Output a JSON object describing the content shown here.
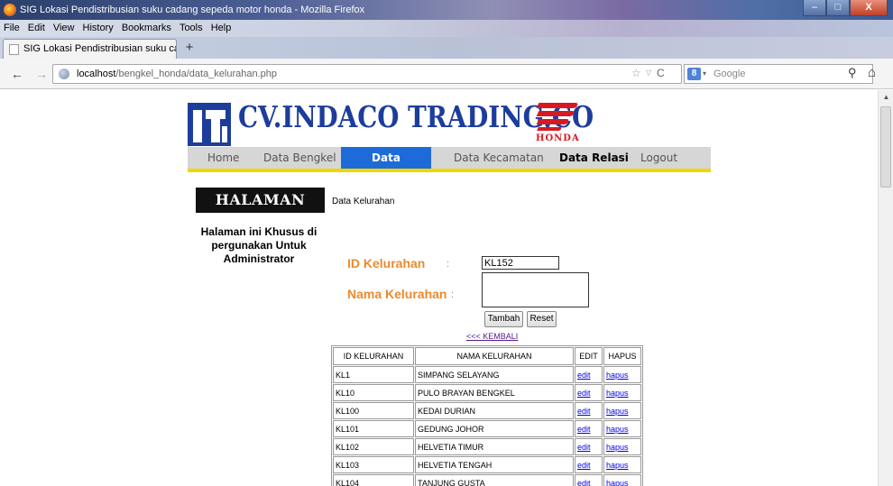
{
  "window": {
    "title": "SIG Lokasi Pendistribusian suku cadang sepeda motor honda - Mozilla Firefox",
    "controls": [
      "–",
      "□",
      "X"
    ]
  },
  "menubar": {
    "items": [
      {
        "label": "File"
      },
      {
        "label": "Edit"
      },
      {
        "label": "View"
      },
      {
        "label": "History"
      },
      {
        "label": "Bookmarks"
      },
      {
        "label": "Tools"
      },
      {
        "label": "Help"
      }
    ]
  },
  "tabs": {
    "active": "SIG Lokasi Pendistribusian suku cadang ...",
    "new_tab": "+"
  },
  "navbar": {
    "back": "←",
    "forward": "→",
    "url_host": "localhost",
    "url_path": "/bengkel_honda/data_kelurahan.php",
    "search_engine_icon": "8",
    "search_placeholder": "Google",
    "icons": {
      "star": "☆",
      "dropdown": "▽",
      "reload": "C",
      "search": "⚲",
      "home": "⌂"
    }
  },
  "page": {
    "company": "CV.INDACO TRADING.CO",
    "honda_brand": "HONDA",
    "menu": [
      {
        "label": "Home"
      },
      {
        "label": "Data Bengkel"
      },
      {
        "label": "Data Kelurahan"
      },
      {
        "label": "Data Kecamatan"
      },
      {
        "label": "Data Relasi"
      },
      {
        "label": "Logout"
      }
    ],
    "admin_title": "HALAMAN ADMIN",
    "section_title": "Data Kelurahan",
    "side_note": "Halaman ini Khusus di pergunakan Untuk Administrator",
    "form": {
      "id_label": "ID Kelurahan",
      "id_colon": ":",
      "id_value": "KL152",
      "nama_label": "Nama Kelurahan",
      "nama_colon": ":",
      "nama_value": "",
      "submit_label": "Tambah",
      "reset_label": "Reset"
    },
    "back_link": "<<< KEMBALI",
    "table": {
      "headers": [
        "ID KELURAHAN",
        "NAMA KELURAHAN",
        "EDIT",
        "HAPUS"
      ],
      "rows": [
        {
          "id": "KL1",
          "nama": "SIMPANG SELAYANG",
          "edit": "edit",
          "hapus": "hapus"
        },
        {
          "id": "KL10",
          "nama": "PULO BRAYAN BENGKEL",
          "edit": "edit",
          "hapus": "hapus"
        },
        {
          "id": "KL100",
          "nama": "KEDAI DURIAN",
          "edit": "edit",
          "hapus": "hapus"
        },
        {
          "id": "KL101",
          "nama": "GEDUNG JOHOR",
          "edit": "edit",
          "hapus": "hapus"
        },
        {
          "id": "KL102",
          "nama": "HELVETIA TIMUR",
          "edit": "edit",
          "hapus": "hapus"
        },
        {
          "id": "KL103",
          "nama": "HELVETIA TENGAH",
          "edit": "edit",
          "hapus": "hapus"
        },
        {
          "id": "KL104",
          "nama": "TANJUNG GUSTA",
          "edit": "edit",
          "hapus": "hapus"
        }
      ]
    }
  }
}
